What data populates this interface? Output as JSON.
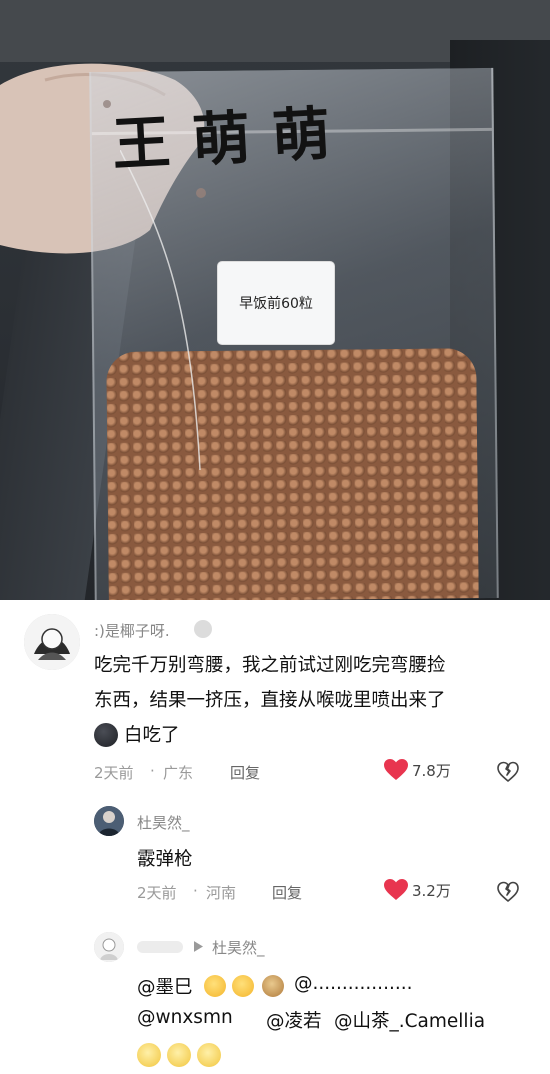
{
  "photo": {
    "handwriting": "王萌萌",
    "label_card": "早饭前60粒"
  },
  "comments": [
    {
      "username": ":)是椰子呀.",
      "text_line1": "吃完千万别弯腰，我之前试过刚吃完弯腰捡",
      "text_line2": "东西，结果一挤压，直接从喉咙里喷出来了",
      "text_line3": "白吃了",
      "time": "2天前",
      "location": "广东",
      "reply_label": "回复",
      "likes": "7.8万"
    },
    {
      "username": "杜昊然_",
      "text": "霰弹枪",
      "time": "2天前",
      "location": "河南",
      "reply_label": "回复",
      "likes": "3.2万"
    },
    {
      "reply_to": "杜昊然_",
      "line1_mention1": "@墨巳",
      "line1_mention2": "@.................",
      "line2_mention1": "@wnxsmn",
      "line2_mention2": "@凌若",
      "line2_mention3": "@山茶_.Camellia"
    }
  ],
  "colors": {
    "heart": "#e8354f",
    "meta": "#9a9a9a",
    "username": "#888888"
  },
  "icons": [
    "heart-icon",
    "broken-heart-icon",
    "reply-arrow-icon",
    "emoji-icon"
  ]
}
